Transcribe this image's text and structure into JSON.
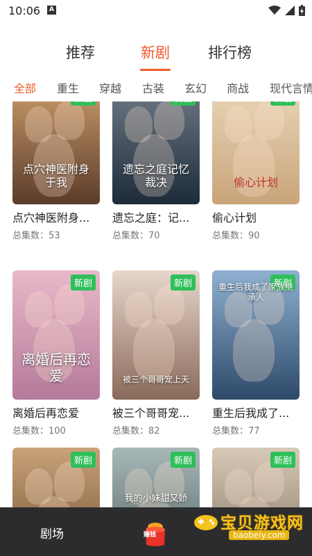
{
  "status": {
    "time": "10:06",
    "notif_letter": "A"
  },
  "tabs": [
    {
      "label": "推荐",
      "active": false
    },
    {
      "label": "新剧",
      "active": true
    },
    {
      "label": "排行榜",
      "active": false
    }
  ],
  "categories": [
    {
      "label": "全部",
      "active": true
    },
    {
      "label": "重生",
      "active": false
    },
    {
      "label": "穿越",
      "active": false
    },
    {
      "label": "古装",
      "active": false
    },
    {
      "label": "玄幻",
      "active": false
    },
    {
      "label": "商战",
      "active": false
    },
    {
      "label": "现代言情",
      "active": false
    }
  ],
  "badge_label": "新剧",
  "dramas": [
    {
      "title": "点穴神医附身...",
      "count": "总集数：53",
      "poster_text": "点穴神医附身于我",
      "colors": [
        "#5b3b2a",
        "#c89a6a"
      ]
    },
    {
      "title": "遗忘之庭：记...",
      "count": "总集数：70",
      "poster_text": "遗忘之庭记忆裁决",
      "colors": [
        "#1c2a3a",
        "#6f7a86"
      ]
    },
    {
      "title": "偷心计划",
      "count": "总集数：90",
      "poster_text": "偷心计划",
      "colors": [
        "#c9a47a",
        "#e8d6b8"
      ]
    },
    {
      "title": "离婚后再恋爱",
      "count": "总集数：100",
      "poster_text": "离婚后再恋爱",
      "colors": [
        "#b47a9a",
        "#e8b8c8"
      ]
    },
    {
      "title": "被三个哥哥宠...",
      "count": "总集数：82",
      "poster_text": "被三个哥哥宠上天",
      "colors": [
        "#8a6a5a",
        "#e7d6cc"
      ]
    },
    {
      "title": "重生后我成了...",
      "count": "总集数：77",
      "poster_text": "重生后我成了家族继承人",
      "colors": [
        "#2e4a6a",
        "#8fb0d0"
      ]
    },
    {
      "title": "",
      "count": "",
      "poster_text": "",
      "colors": [
        "#6a4a2a",
        "#c9a27a"
      ]
    },
    {
      "title": "",
      "count": "",
      "poster_text": "我的小妹甜又娇",
      "colors": [
        "#4a5a5a",
        "#a8b8b8"
      ]
    },
    {
      "title": "",
      "count": "",
      "poster_text": "",
      "colors": [
        "#7a6a5a",
        "#d8cab8"
      ]
    }
  ],
  "bottom_nav": {
    "theater_label": "剧场",
    "earn_label": "赚钱"
  },
  "watermark": {
    "text": "宝贝游戏网",
    "url": "baobeiy.com"
  }
}
